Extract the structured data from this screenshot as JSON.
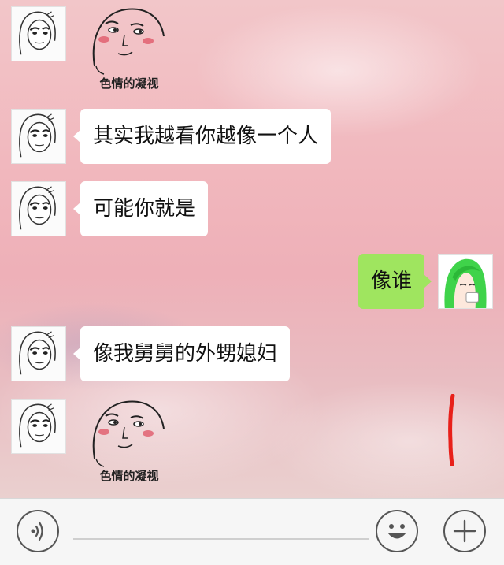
{
  "messages": [
    {
      "side": "left",
      "type": "sticker",
      "caption": "色情的凝视"
    },
    {
      "side": "left",
      "type": "text",
      "text": "其实我越看你越像一个人"
    },
    {
      "side": "left",
      "type": "text",
      "text": "可能你就是"
    },
    {
      "side": "right",
      "type": "text",
      "text": "像谁"
    },
    {
      "side": "left",
      "type": "text",
      "text": "像我舅舅的外甥媳妇"
    },
    {
      "side": "left",
      "type": "sticker",
      "caption": "色情的凝视"
    }
  ],
  "toolbar": {
    "voice_icon": "voice-icon",
    "emoji_icon": "emoji-icon",
    "add_icon": "plus-icon"
  },
  "colors": {
    "sent_bubble": "#9fe55f",
    "received_bubble": "#ffffff",
    "annotation_mark": "#e8201a"
  }
}
